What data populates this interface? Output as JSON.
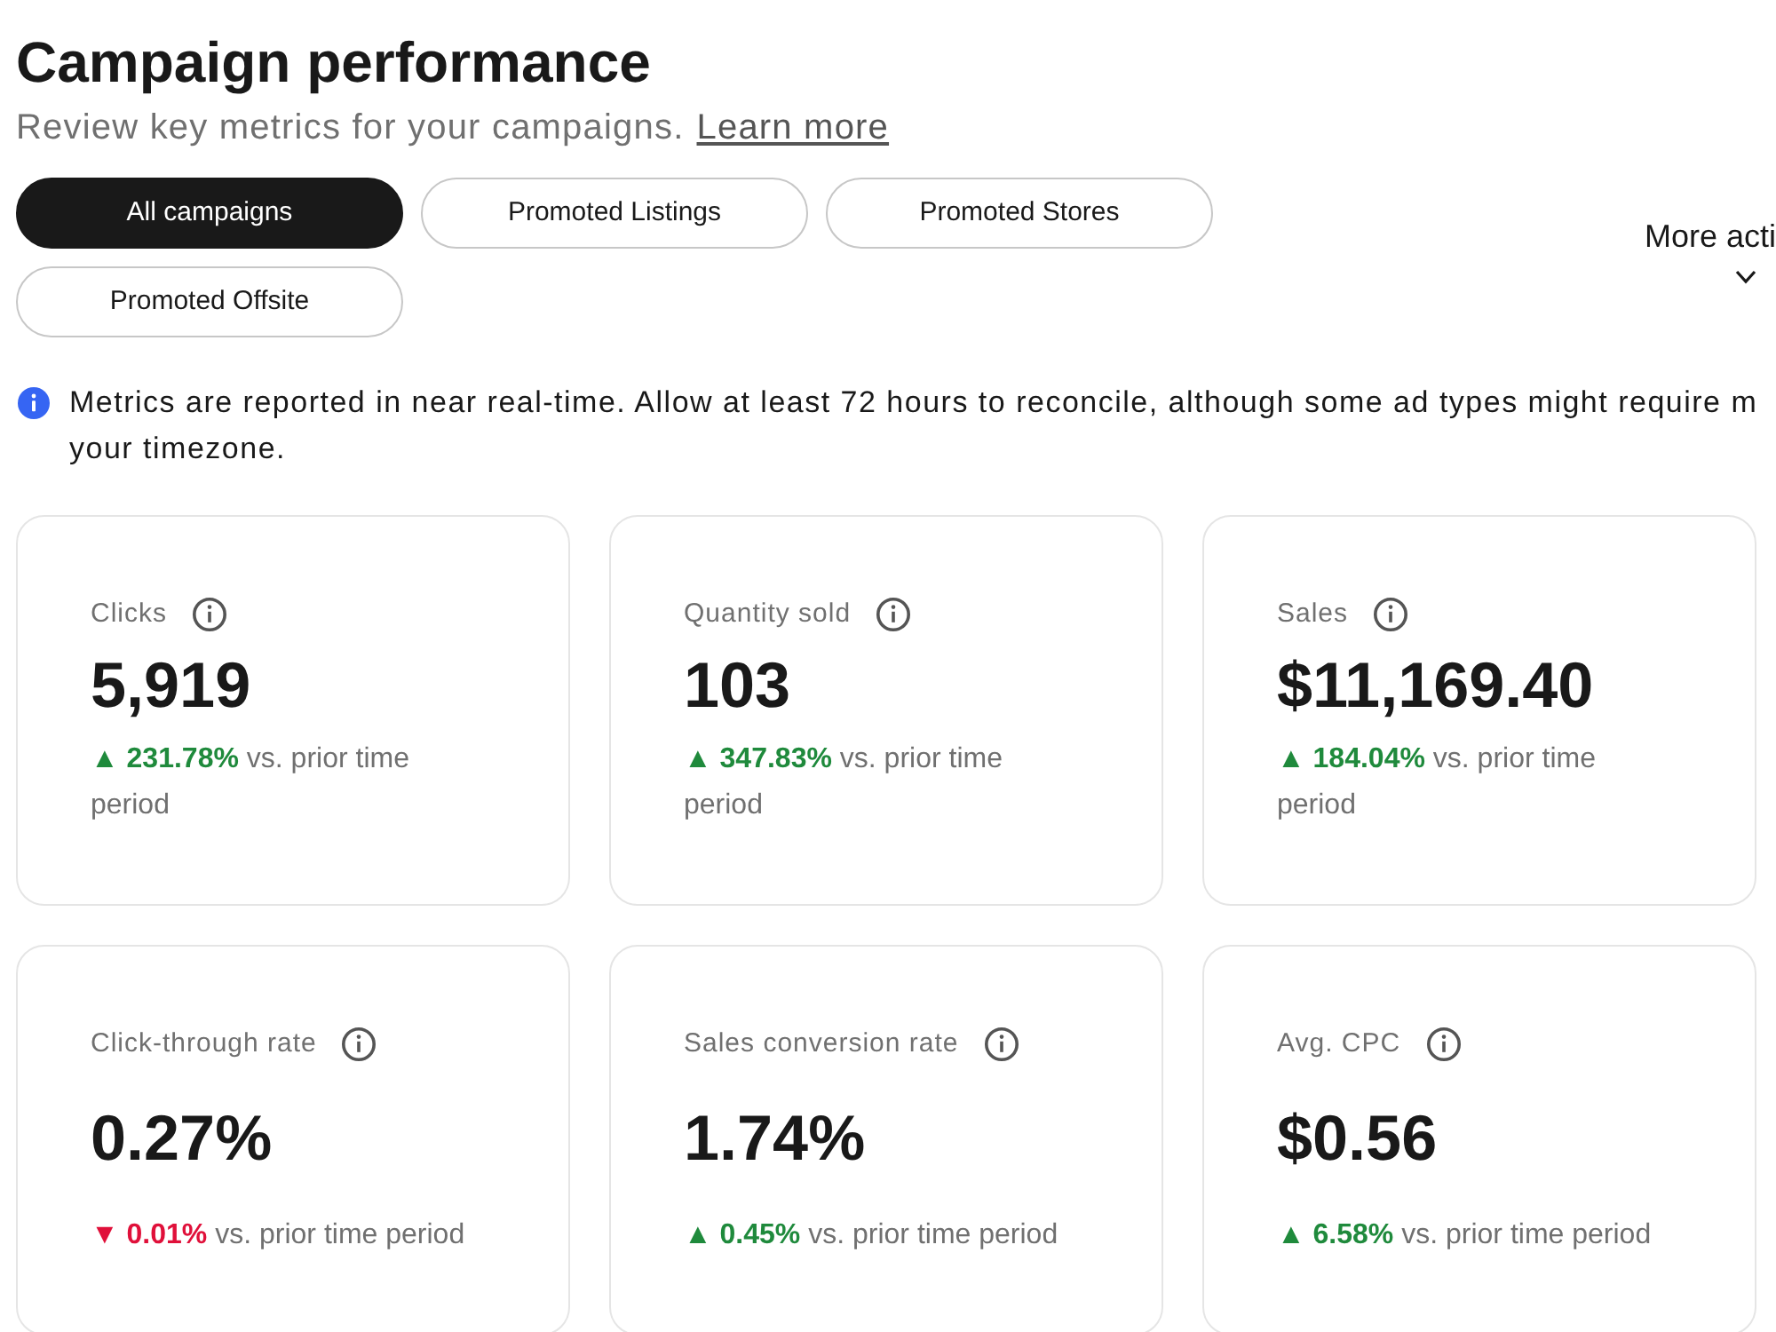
{
  "header": {
    "title": "Campaign performance",
    "subtitle": "Review key metrics for your campaigns.",
    "link": "Learn more"
  },
  "tabs": [
    {
      "label": "All campaigns",
      "selected": true
    },
    {
      "label": "Promoted Listings",
      "selected": false
    },
    {
      "label": "Promoted Stores",
      "selected": false
    },
    {
      "label": "Promoted Offsite",
      "selected": false
    }
  ],
  "more_actions": {
    "label": "More acti"
  },
  "notice": {
    "lines": [
      "Metrics are reported in near real-time. Allow at least 72 hours to reconcile, although some ad types might require m",
      "your timezone."
    ]
  },
  "metrics": [
    {
      "label": "Clicks",
      "value": "5,919",
      "kind": "up",
      "change": "**▲ 231.78%** vs. prior time period"
    },
    {
      "label": "Quantity sold",
      "value": "103",
      "kind": "up",
      "change": "**▲ 347.83%** vs. prior time period"
    },
    {
      "label": "Sales",
      "value": "$11,169.40",
      "kind": "up",
      "change": "**▲ 184.04%** vs. prior time period"
    },
    {
      "label": "Click-through rate",
      "value": "0.27%",
      "kind": "down",
      "change": "**▼ 0.01%** vs. prior time period"
    },
    {
      "label": "Sales conversion rate",
      "value": "1.74%",
      "kind": "up",
      "change": "**▲ 0.45%** vs. prior time period"
    },
    {
      "label": "Avg. CPC",
      "value": "$0.56",
      "kind": "up",
      "change": "**▲ 6.58%** vs. prior time period"
    }
  ]
}
